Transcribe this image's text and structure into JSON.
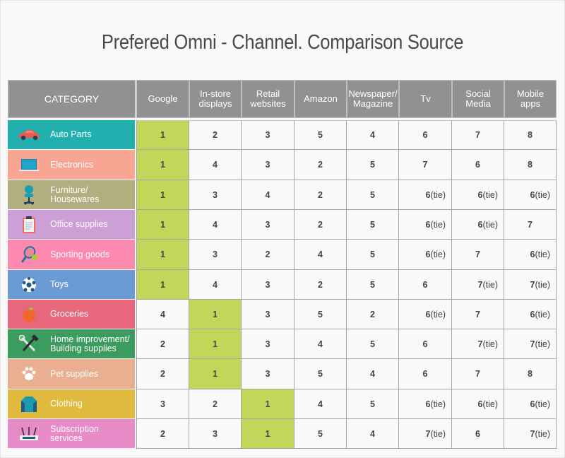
{
  "chart_data": {
    "type": "table",
    "title": "Prefered Omni - Channel. Comparison Source",
    "row_header": "CATEGORY",
    "columns": [
      "Google",
      "In-store displays",
      "Retail websites",
      "Amazon",
      "Newspaper/ Magazine",
      "Tv",
      "Social Media",
      "Mobile apps"
    ],
    "column_lines": [
      [
        "Google"
      ],
      [
        "In-store",
        "displays"
      ],
      [
        "Retail",
        "websites"
      ],
      [
        "Amazon"
      ],
      [
        "Newspaper/",
        "Magazine"
      ],
      [
        "Tv"
      ],
      [
        "Social",
        "Media"
      ],
      [
        "Mobile",
        "apps"
      ]
    ],
    "rows": [
      {
        "category": "Auto Parts",
        "lines": [
          "Auto Parts"
        ],
        "icon": "car-icon",
        "color": "#21b0ad",
        "values": [
          "1",
          "2",
          "3",
          "5",
          "4",
          "6",
          "7",
          "8"
        ]
      },
      {
        "category": "Electronics",
        "lines": [
          "Electronics"
        ],
        "icon": "laptop-icon",
        "color": "#f9a594",
        "values": [
          "1",
          "4",
          "3",
          "2",
          "5",
          "7",
          "6",
          "8"
        ]
      },
      {
        "category": "Furniture/ Housewares",
        "lines": [
          "Furniture/",
          "Housewares"
        ],
        "icon": "office-chair-icon",
        "color": "#b3ae7f",
        "values": [
          "1",
          "3",
          "4",
          "2",
          "5",
          "6 (tie)",
          "6 (tie)",
          "6 (tie)"
        ]
      },
      {
        "category": "Office supplies",
        "lines": [
          "Office supplies"
        ],
        "icon": "clipboard-icon",
        "color": "#cc9fd6",
        "values": [
          "1",
          "4",
          "3",
          "2",
          "5",
          "6 (tie)",
          "6 (tie)",
          "7"
        ]
      },
      {
        "category": "Sporting goods",
        "lines": [
          "Sporting goods"
        ],
        "icon": "tennis-racket-icon",
        "color": "#fc89ae",
        "values": [
          "1",
          "3",
          "2",
          "4",
          "5",
          "6 (tie)",
          "7",
          "6 (tie)"
        ]
      },
      {
        "category": "Toys",
        "lines": [
          "Toys"
        ],
        "icon": "soccer-ball-icon",
        "color": "#6b9bd4",
        "values": [
          "1",
          "4",
          "3",
          "2",
          "5",
          "6",
          "7 (tie)",
          "7 (tie)"
        ]
      },
      {
        "category": "Groceries",
        "lines": [
          "Groceries"
        ],
        "icon": "apple-icon",
        "color": "#e9677c",
        "values": [
          "4",
          "1",
          "3",
          "5",
          "2",
          "6 (tie)",
          "7",
          "6 (tie)"
        ]
      },
      {
        "category": "Home improvement/ Building supplies",
        "lines": [
          "Home improvement/",
          "Building supplies"
        ],
        "icon": "tools-icon",
        "color": "#3c9b5f",
        "values": [
          "2",
          "1",
          "3",
          "4",
          "5",
          "6",
          "7 (tie)",
          "7 (tie)"
        ]
      },
      {
        "category": "Pet supplies",
        "lines": [
          "Pet supplies"
        ],
        "icon": "paw-icon",
        "color": "#eaae90",
        "values": [
          "2",
          "1",
          "3",
          "5",
          "4",
          "6",
          "7",
          "8"
        ]
      },
      {
        "category": "Clothing",
        "lines": [
          "Clothing"
        ],
        "icon": "sweater-icon",
        "color": "#e0b93f",
        "values": [
          "3",
          "2",
          "1",
          "4",
          "5",
          "6 (tie)",
          "6 (tie)",
          "6 (tie)"
        ]
      },
      {
        "category": "Subscription services",
        "lines": [
          "Subscription",
          "services"
        ],
        "icon": "router-icon",
        "color": "#e78ac8",
        "values": [
          "2",
          "3",
          "1",
          "5",
          "4",
          "7 (tie)",
          "6",
          "7 (tie)"
        ]
      }
    ],
    "highlight_value": "1",
    "highlight_color": "#c4d65a",
    "header_color": "#909192"
  }
}
